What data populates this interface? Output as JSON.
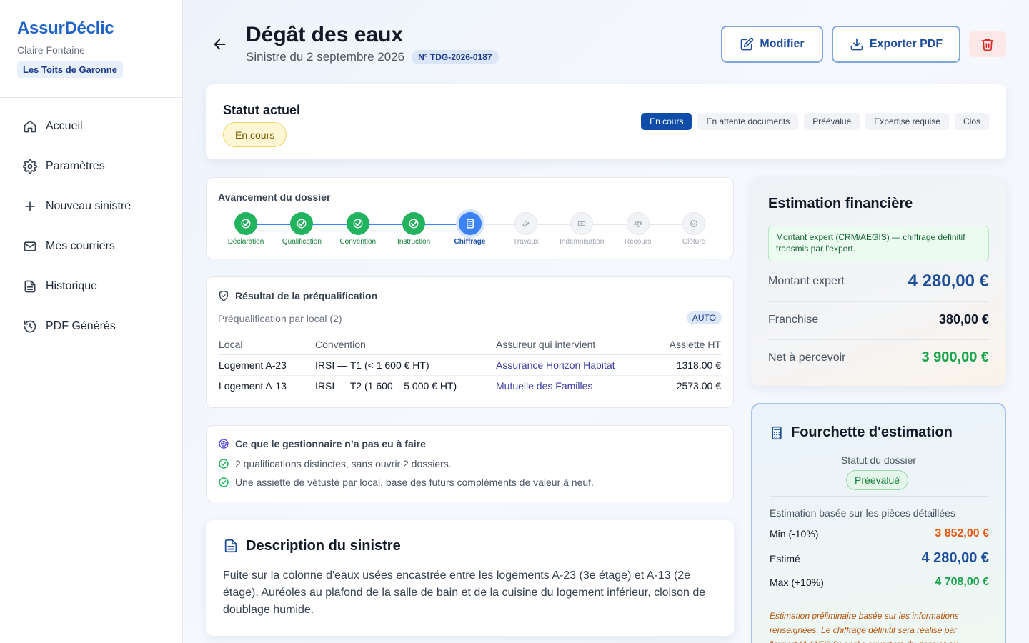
{
  "app": {
    "brand": "AssurDéclic",
    "user": "Claire Fontaine",
    "org": "Les Toits de Garonne"
  },
  "sidebar": {
    "items": [
      {
        "label": "Accueil",
        "icon": "home-icon"
      },
      {
        "label": "Paramètres",
        "icon": "gear-icon"
      },
      {
        "label": "Nouveau sinistre",
        "icon": "plus-icon"
      },
      {
        "label": "Mes courriers",
        "icon": "mail-icon"
      },
      {
        "label": "Historique",
        "icon": "document-icon"
      },
      {
        "label": "PDF Générés",
        "icon": "history-icon"
      }
    ]
  },
  "header": {
    "title": "Dégât des eaux",
    "subtitle": "Sinistre du 2 septembre 2026",
    "reference": "N° TDG-2026-0187",
    "modify_label": "Modifier",
    "export_label": "Exporter PDF"
  },
  "status": {
    "title": "Statut actuel",
    "current": "En cours",
    "tabs": [
      "En cours",
      "En attente documents",
      "Préévalué",
      "Expertise requise",
      "Clos"
    ],
    "active_tab": 0
  },
  "progress": {
    "title": "Avancement du dossier",
    "steps": [
      {
        "label": "Déclaration",
        "state": "done",
        "icon": "check-icon"
      },
      {
        "label": "Qualification",
        "state": "done",
        "icon": "check-icon"
      },
      {
        "label": "Convention",
        "state": "done",
        "icon": "check-icon"
      },
      {
        "label": "Instruction",
        "state": "done",
        "icon": "check-icon"
      },
      {
        "label": "Chiffrage",
        "state": "current",
        "icon": "calculator-icon"
      },
      {
        "label": "Travaux",
        "state": "todo",
        "icon": "wrench-icon"
      },
      {
        "label": "Indemnisation",
        "state": "todo",
        "icon": "banknote-icon"
      },
      {
        "label": "Recours",
        "state": "todo",
        "icon": "scale-icon"
      },
      {
        "label": "Clôture",
        "state": "todo",
        "icon": "check-circle-icon"
      }
    ]
  },
  "prequal": {
    "title": "Résultat de la préqualification",
    "subtitle": "Préqualification par local (2)",
    "badge": "AUTO",
    "columns": [
      "Local",
      "Convention",
      "Assureur qui intervient",
      "Assiette HT"
    ],
    "rows": [
      {
        "local": "Logement A-23",
        "convention": "IRSI — T1 (< 1 600 € HT)",
        "insurer": "Assurance Horizon Habitat",
        "base": "1318.00 €"
      },
      {
        "local": "Logement A-13",
        "convention": "IRSI — T2 (1 600 – 5 000 € HT)",
        "insurer": "Mutuelle des Familles",
        "base": "2573.00 €"
      }
    ]
  },
  "benefits": {
    "title": "Ce que le gestionnaire n’a pas eu à faire",
    "items": [
      "2 qualifications distinctes, sans ouvrir 2 dossiers.",
      "Une assiette de vétusté par local, base des futurs compléments de valeur à neuf."
    ]
  },
  "description": {
    "title": "Description du sinistre",
    "text": "Fuite sur la colonne d'eaux usées encastrée entre les logements A-23 (3e étage) et A-13 (2e étage). Auréoles au plafond de la salle de bain et de la cuisine du logement inférieur, cloison de doublage humide."
  },
  "financial": {
    "title": "Estimation financière",
    "note": "Montant expert (CRM/AEGIS) — chiffrage définitif transmis par l'expert.",
    "rows": [
      {
        "label": "Montant expert",
        "value": "4 280,00 €",
        "color": "#1d4f9c"
      },
      {
        "label": "Franchise",
        "value": "380,00 €",
        "color": "#111827"
      },
      {
        "label": "Net à percevoir",
        "value": "3 900,00 €",
        "color": "#16a34a"
      }
    ]
  },
  "range": {
    "title": "Fourchette d'estimation",
    "status_label": "Statut du dossier",
    "status_value": "Préévalué",
    "basis": "Estimation basée sur les pièces détaillées",
    "rows": [
      {
        "label": "Min (-10%)",
        "value": "3 852,00 €",
        "color": "#ea580c"
      },
      {
        "label": "Estimé",
        "value": "4 280,00 €",
        "color": "#1d4f9c"
      },
      {
        "label": "Max (+10%)",
        "value": "4 708,00 €",
        "color": "#16a34a"
      }
    ],
    "note": "Estimation préliminaire basée sur les informations renseignées. Le chiffrage définitif sera réalisé par l'expert IA (AEGIS) après ouverture du dossier au"
  }
}
